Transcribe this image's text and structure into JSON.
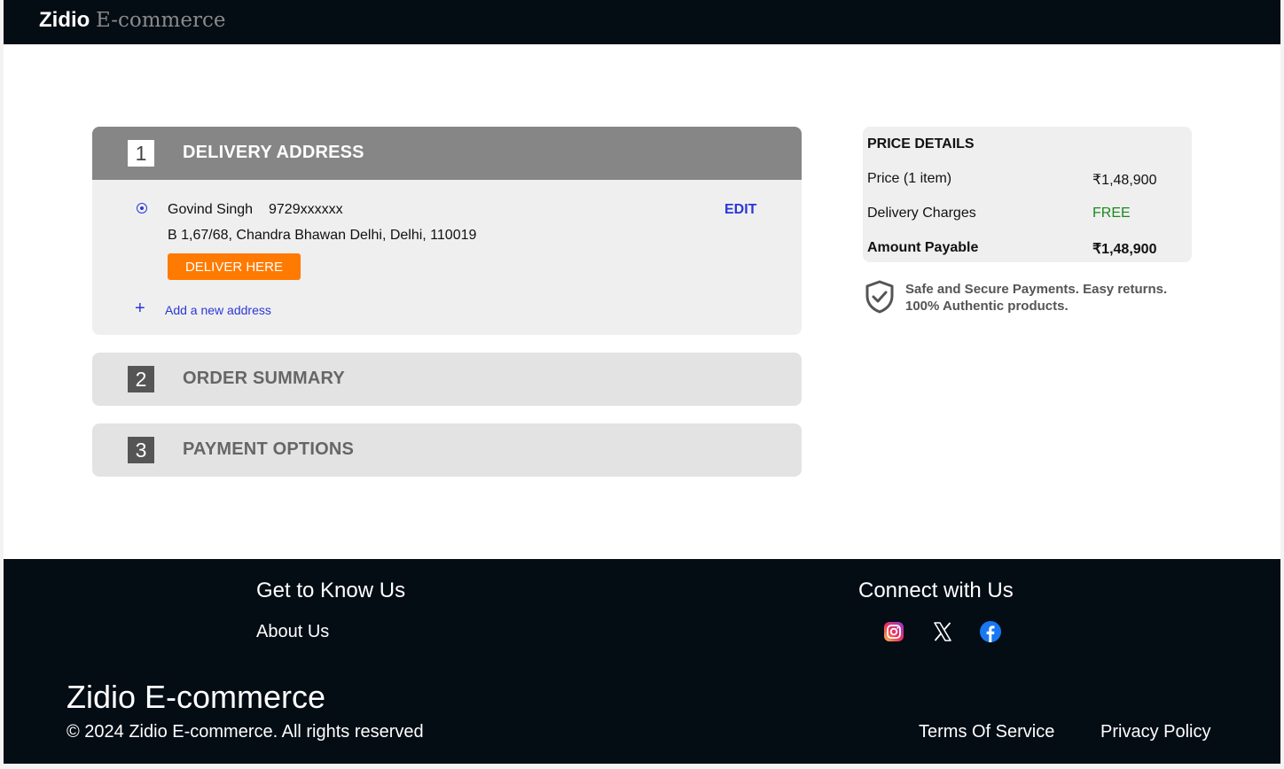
{
  "header": {
    "brand_main": "Zidio",
    "brand_sub": "E-commerce"
  },
  "steps": [
    {
      "number": "1",
      "title": "DELIVERY ADDRESS"
    },
    {
      "number": "2",
      "title": "ORDER SUMMARY"
    },
    {
      "number": "3",
      "title": "PAYMENT OPTIONS"
    }
  ],
  "address": {
    "name": "Govind Singh",
    "phone": "9729xxxxxx",
    "line": "B 1,67/68, Chandra Bhawan Delhi, Delhi, 110019",
    "edit_label": "EDIT",
    "deliver_label": "DELIVER HERE",
    "add_label": "Add a new address"
  },
  "price_details": {
    "heading": "PRICE DETAILS",
    "rows": [
      {
        "label": "Price (1 item)",
        "value": "₹1,48,900"
      },
      {
        "label": "Delivery Charges",
        "value": "FREE"
      },
      {
        "label": "Amount Payable",
        "value": "₹1,48,900"
      }
    ],
    "free_color": "#1a8a1a",
    "secure_line1": "Safe and Secure Payments. Easy returns.",
    "secure_line2": "100% Authentic products."
  },
  "footer": {
    "know_heading": "Get to Know Us",
    "about_label": "About Us",
    "connect_heading": "Connect with Us",
    "social_icons": [
      "instagram-icon",
      "x-icon",
      "facebook-icon"
    ],
    "brand": "Zidio E-commerce",
    "copyright": "© 2024 Zidio E-commerce. All rights reserved",
    "terms_label": "Terms Of Service",
    "privacy_label": "Privacy Policy"
  },
  "colors": {
    "accent_blue": "#2a37d8",
    "deliver_orange": "#ff7a00",
    "dark_bg": "#040c14"
  }
}
